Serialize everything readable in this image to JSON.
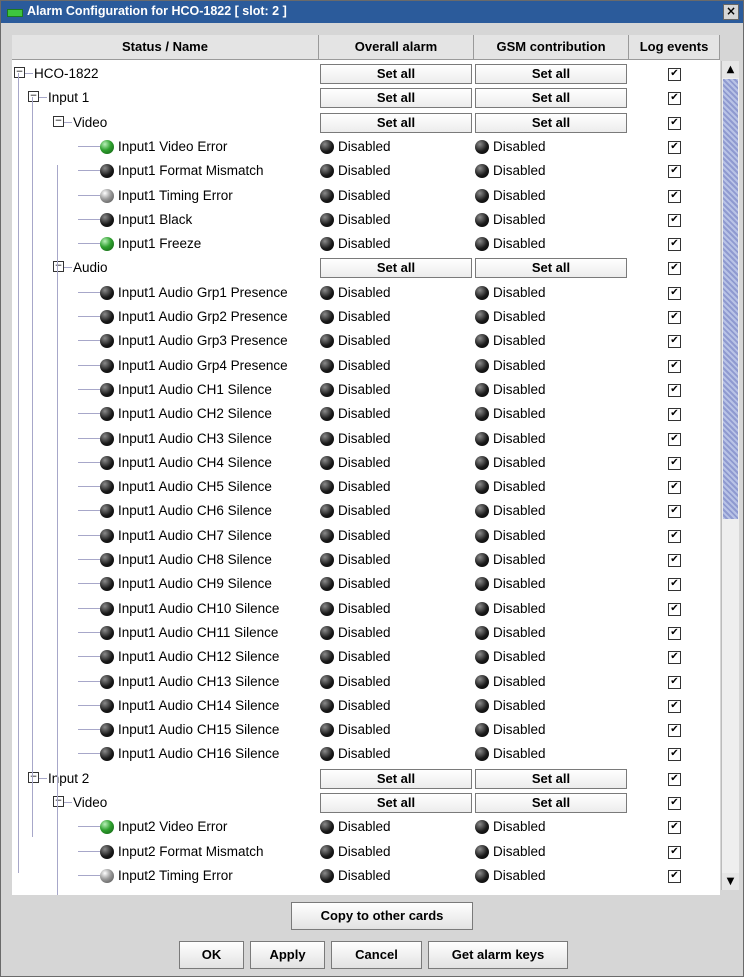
{
  "window": {
    "title": "Alarm Configuration for HCO-1822 [ slot: 2 ]",
    "close_label": "×"
  },
  "columns": [
    "Status / Name",
    "Overall alarm",
    "GSM contribution",
    "Log events"
  ],
  "rows": [
    {
      "type": "group",
      "level": 0,
      "label": "HCO-1822",
      "overall": "Set all",
      "gsm": "Set all",
      "log": "✔"
    },
    {
      "type": "group",
      "level": 1,
      "label": "Input 1",
      "overall": "Set all",
      "gsm": "Set all",
      "log": "✔"
    },
    {
      "type": "group",
      "level": 2,
      "label": "Video",
      "overall": "Set all",
      "gsm": "Set all",
      "log": "✔"
    },
    {
      "type": "item",
      "level": 3,
      "led": "green",
      "label": "Input1 Video Error",
      "overall": "Disabled",
      "gsm": "Disabled",
      "log": "✔"
    },
    {
      "type": "item",
      "level": 3,
      "led": "dark",
      "label": "Input1 Format Mismatch",
      "overall": "Disabled",
      "gsm": "Disabled",
      "log": "✔"
    },
    {
      "type": "item",
      "level": 3,
      "led": "grey",
      "label": "Input1 Timing Error",
      "overall": "Disabled",
      "gsm": "Disabled",
      "log": "✔"
    },
    {
      "type": "item",
      "level": 3,
      "led": "dark",
      "label": "Input1 Black",
      "overall": "Disabled",
      "gsm": "Disabled",
      "log": "✔"
    },
    {
      "type": "item",
      "level": 3,
      "led": "green",
      "label": "Input1 Freeze",
      "overall": "Disabled",
      "gsm": "Disabled",
      "log": "✔"
    },
    {
      "type": "group",
      "level": 2,
      "label": "Audio",
      "overall": "Set all",
      "gsm": "Set all",
      "log": "✔"
    },
    {
      "type": "item",
      "level": 3,
      "led": "dark",
      "label": "Input1 Audio Grp1 Presence",
      "overall": "Disabled",
      "gsm": "Disabled",
      "log": "✔"
    },
    {
      "type": "item",
      "level": 3,
      "led": "dark",
      "label": "Input1 Audio Grp2 Presence",
      "overall": "Disabled",
      "gsm": "Disabled",
      "log": "✔"
    },
    {
      "type": "item",
      "level": 3,
      "led": "dark",
      "label": "Input1 Audio Grp3 Presence",
      "overall": "Disabled",
      "gsm": "Disabled",
      "log": "✔"
    },
    {
      "type": "item",
      "level": 3,
      "led": "dark",
      "label": "Input1 Audio Grp4 Presence",
      "overall": "Disabled",
      "gsm": "Disabled",
      "log": "✔"
    },
    {
      "type": "item",
      "level": 3,
      "led": "dark",
      "label": "Input1 Audio CH1 Silence",
      "overall": "Disabled",
      "gsm": "Disabled",
      "log": "✔"
    },
    {
      "type": "item",
      "level": 3,
      "led": "dark",
      "label": "Input1 Audio CH2 Silence",
      "overall": "Disabled",
      "gsm": "Disabled",
      "log": "✔"
    },
    {
      "type": "item",
      "level": 3,
      "led": "dark",
      "label": "Input1 Audio CH3 Silence",
      "overall": "Disabled",
      "gsm": "Disabled",
      "log": "✔"
    },
    {
      "type": "item",
      "level": 3,
      "led": "dark",
      "label": "Input1 Audio CH4 Silence",
      "overall": "Disabled",
      "gsm": "Disabled",
      "log": "✔"
    },
    {
      "type": "item",
      "level": 3,
      "led": "dark",
      "label": "Input1 Audio CH5 Silence",
      "overall": "Disabled",
      "gsm": "Disabled",
      "log": "✔"
    },
    {
      "type": "item",
      "level": 3,
      "led": "dark",
      "label": "Input1 Audio CH6 Silence",
      "overall": "Disabled",
      "gsm": "Disabled",
      "log": "✔"
    },
    {
      "type": "item",
      "level": 3,
      "led": "dark",
      "label": "Input1 Audio CH7 Silence",
      "overall": "Disabled",
      "gsm": "Disabled",
      "log": "✔"
    },
    {
      "type": "item",
      "level": 3,
      "led": "dark",
      "label": "Input1 Audio CH8 Silence",
      "overall": "Disabled",
      "gsm": "Disabled",
      "log": "✔"
    },
    {
      "type": "item",
      "level": 3,
      "led": "dark",
      "label": "Input1 Audio CH9 Silence",
      "overall": "Disabled",
      "gsm": "Disabled",
      "log": "✔"
    },
    {
      "type": "item",
      "level": 3,
      "led": "dark",
      "label": "Input1 Audio CH10 Silence",
      "overall": "Disabled",
      "gsm": "Disabled",
      "log": "✔"
    },
    {
      "type": "item",
      "level": 3,
      "led": "dark",
      "label": "Input1 Audio CH11 Silence",
      "overall": "Disabled",
      "gsm": "Disabled",
      "log": "✔"
    },
    {
      "type": "item",
      "level": 3,
      "led": "dark",
      "label": "Input1 Audio CH12 Silence",
      "overall": "Disabled",
      "gsm": "Disabled",
      "log": "✔"
    },
    {
      "type": "item",
      "level": 3,
      "led": "dark",
      "label": "Input1 Audio CH13 Silence",
      "overall": "Disabled",
      "gsm": "Disabled",
      "log": "✔"
    },
    {
      "type": "item",
      "level": 3,
      "led": "dark",
      "label": "Input1 Audio CH14 Silence",
      "overall": "Disabled",
      "gsm": "Disabled",
      "log": "✔"
    },
    {
      "type": "item",
      "level": 3,
      "led": "dark",
      "label": "Input1 Audio CH15 Silence",
      "overall": "Disabled",
      "gsm": "Disabled",
      "log": "✔"
    },
    {
      "type": "item",
      "level": 3,
      "led": "dark",
      "label": "Input1 Audio CH16 Silence",
      "overall": "Disabled",
      "gsm": "Disabled",
      "log": "✔"
    },
    {
      "type": "group",
      "level": 1,
      "label": "Input 2",
      "overall": "Set all",
      "gsm": "Set all",
      "log": "✔"
    },
    {
      "type": "group",
      "level": 2,
      "label": "Video",
      "overall": "Set all",
      "gsm": "Set all",
      "log": "✔"
    },
    {
      "type": "item",
      "level": 3,
      "led": "green",
      "label": "Input2 Video Error",
      "overall": "Disabled",
      "gsm": "Disabled",
      "log": "✔"
    },
    {
      "type": "item",
      "level": 3,
      "led": "dark",
      "label": "Input2 Format Mismatch",
      "overall": "Disabled",
      "gsm": "Disabled",
      "log": "✔"
    },
    {
      "type": "item",
      "level": 3,
      "led": "grey",
      "label": "Input2 Timing Error",
      "overall": "Disabled",
      "gsm": "Disabled",
      "log": "✔"
    }
  ],
  "copy_button": "Copy to other cards",
  "buttons": [
    "OK",
    "Apply",
    "Cancel",
    "Get alarm keys"
  ],
  "colors": {
    "titlebar": "#2b5b9b",
    "led_green": "#2fa02f",
    "tree_line": "#a7a7c9"
  }
}
